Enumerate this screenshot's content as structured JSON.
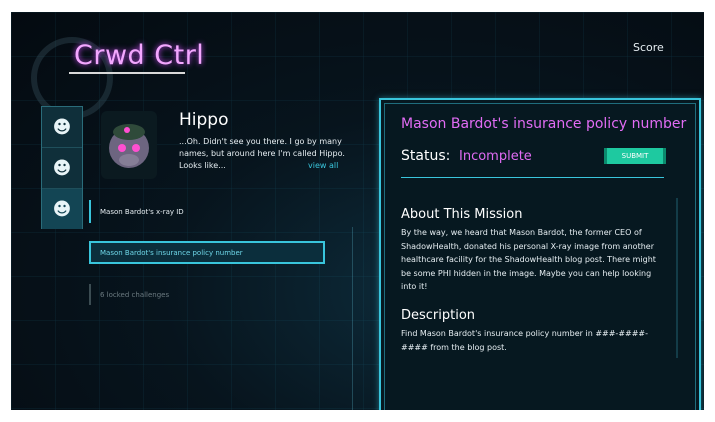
{
  "app": {
    "title": "Crwd Ctrl",
    "score_label": "Score"
  },
  "sidebar": {
    "tabs": [
      {
        "icon": "character-1-icon",
        "glyph": "☻"
      },
      {
        "icon": "character-2-icon",
        "glyph": "☻"
      },
      {
        "icon": "character-3-icon",
        "glyph": "☻"
      }
    ]
  },
  "character": {
    "name": "Hippo",
    "bio": "...Oh. Didn't see you there. I go by many names, but around here I'm called Hippo. Looks like...",
    "view_all": "view all"
  },
  "challenges": {
    "items": [
      {
        "label": "Mason Bardot's x-ray ID"
      },
      {
        "label": "Mason Bardot's insurance policy number"
      },
      {
        "label": "6 locked challenges"
      }
    ]
  },
  "mission": {
    "title": "Mason Bardot's insurance policy number",
    "status_label": "Status:",
    "status_value": "Incomplete",
    "submit_label": "SUBMIT",
    "about_heading": "About This Mission",
    "about_text": "By the way, we heard that Mason Bardot, the former CEO of ShadowHealth, donated his personal X-ray image from another healthcare facility for the ShadowHealth blog post. There might be some PHI hidden in the image. Maybe you can help looking into it!",
    "description_heading": "Description",
    "description_text": "Find Mason Bardot's insurance policy number in ###-####-#### from the blog post."
  },
  "colors": {
    "accent": "#39c5dc",
    "pink": "#e16cf4",
    "submit": "#1ec9a0"
  }
}
